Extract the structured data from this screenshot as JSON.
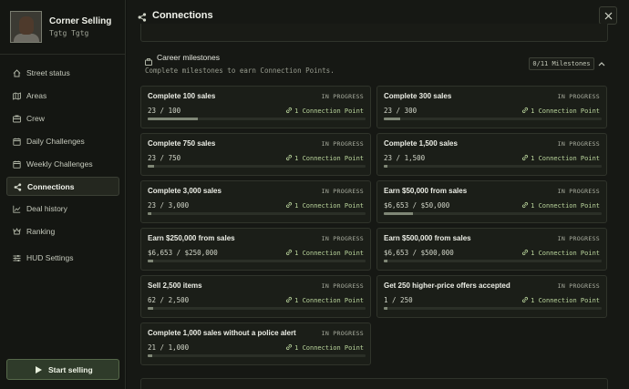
{
  "profile": {
    "name": "Corner Selling",
    "subtitle": "Tgtg Tgtg"
  },
  "sidebar": {
    "items": [
      {
        "label": "Street status",
        "icon": "home-icon",
        "active": false
      },
      {
        "label": "Areas",
        "icon": "map-icon",
        "active": false
      },
      {
        "label": "Crew",
        "icon": "crew-icon",
        "active": false
      },
      {
        "label": "Daily Challenges",
        "icon": "calendar-icon",
        "active": false
      },
      {
        "label": "Weekly Challenges",
        "icon": "calendar-icon",
        "active": false
      },
      {
        "label": "Connections",
        "icon": "share-icon",
        "active": true
      },
      {
        "label": "Deal history",
        "icon": "chart-icon",
        "active": false
      },
      {
        "label": "Ranking",
        "icon": "ranking-icon",
        "active": false
      },
      {
        "label": "HUD Settings",
        "icon": "sliders-icon",
        "active": false
      }
    ],
    "start_button": "Start selling"
  },
  "header": {
    "title": "Connections",
    "icon": "share-icon"
  },
  "section": {
    "title": "Career milestones",
    "description": "Complete milestones to earn Connection Points.",
    "badge": "0/11 Milestones",
    "icon": "briefcase-icon"
  },
  "milestones": [
    {
      "title": "Complete 100 sales",
      "status": "IN PROGRESS",
      "progress": "23 / 100",
      "reward": "1 Connection Point",
      "fraction": 0.23
    },
    {
      "title": "Complete 300 sales",
      "status": "IN PROGRESS",
      "progress": "23 / 300",
      "reward": "1 Connection Point",
      "fraction": 0.077
    },
    {
      "title": "Complete 750 sales",
      "status": "IN PROGRESS",
      "progress": "23 / 750",
      "reward": "1 Connection Point",
      "fraction": 0.031
    },
    {
      "title": "Complete 1,500 sales",
      "status": "IN PROGRESS",
      "progress": "23 / 1,500",
      "reward": "1 Connection Point",
      "fraction": 0.015
    },
    {
      "title": "Complete 3,000 sales",
      "status": "IN PROGRESS",
      "progress": "23 / 3,000",
      "reward": "1 Connection Point",
      "fraction": 0.008
    },
    {
      "title": "Earn $50,000 from sales",
      "status": "IN PROGRESS",
      "progress": "$6,653 / $50,000",
      "reward": "1 Connection Point",
      "fraction": 0.133
    },
    {
      "title": "Earn $250,000 from sales",
      "status": "IN PROGRESS",
      "progress": "$6,653 / $250,000",
      "reward": "1 Connection Point",
      "fraction": 0.027
    },
    {
      "title": "Earn $500,000 from sales",
      "status": "IN PROGRESS",
      "progress": "$6,653 / $500,000",
      "reward": "1 Connection Point",
      "fraction": 0.013
    },
    {
      "title": "Sell 2,500 items",
      "status": "IN PROGRESS",
      "progress": "62 / 2,500",
      "reward": "1 Connection Point",
      "fraction": 0.025
    },
    {
      "title": "Get 250 higher-price offers accepted",
      "status": "IN PROGRESS",
      "progress": "1 / 250",
      "reward": "1 Connection Point",
      "fraction": 0.004
    },
    {
      "title": "Complete 1,000 sales without a police alert",
      "status": "IN PROGRESS",
      "progress": "21 / 1,000",
      "reward": "1 Connection Point",
      "fraction": 0.021
    }
  ],
  "colors": {
    "background": "#111310",
    "panel": "#1b1e18",
    "accent": "#b9d49b",
    "button": "#2f3b2a"
  }
}
